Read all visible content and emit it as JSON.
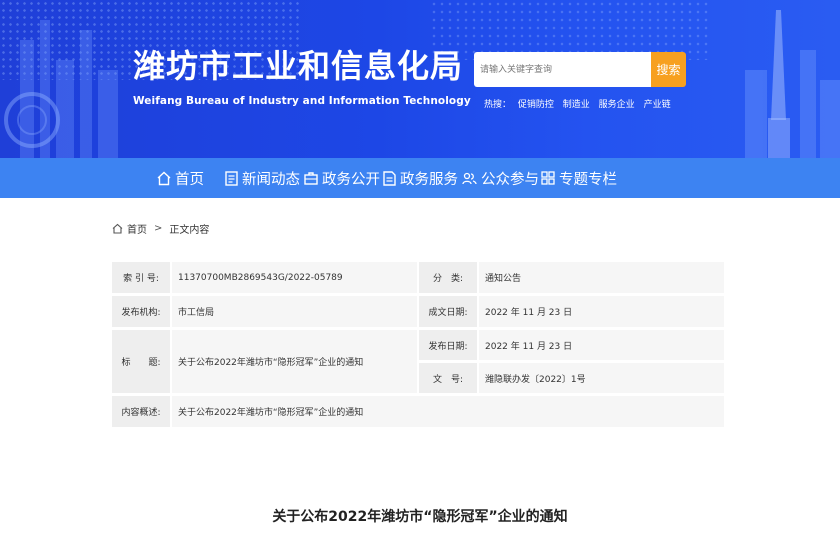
{
  "header": {
    "title": "潍坊市工业和信息化局",
    "subtitle": "Weifang Bureau of Industry and Information Technology",
    "search": {
      "placeholder": "请输入关键字查询",
      "button_label": "搜索"
    },
    "hot": {
      "label": "热搜：",
      "links": [
        "促销防控",
        "制造业",
        "服务企业",
        "产业链"
      ]
    }
  },
  "nav": {
    "items": [
      {
        "label": "首页",
        "icon": "home-icon"
      },
      {
        "label": "新闻动态",
        "icon": "news-icon"
      },
      {
        "label": "政务公开",
        "icon": "briefcase-icon"
      },
      {
        "label": "政务服务",
        "icon": "document-icon"
      },
      {
        "label": "公众参与",
        "icon": "people-icon"
      },
      {
        "label": "专题专栏",
        "icon": "grid-icon"
      }
    ]
  },
  "breadcrumb": {
    "home": "首页",
    "separator": ">",
    "current": "正文内容"
  },
  "meta": {
    "index_label": "索 引 号:",
    "index_value": "11370700MB2869543G/2022-05789",
    "category_label": "分　类:",
    "category_value": "通知公告",
    "publisher_label": "发布机构:",
    "publisher_value": "市工信局",
    "created_label": "成文日期:",
    "created_value": "2022 年 11 月 23 日",
    "title_label": "标　　题:",
    "title_value": "关于公布2022年潍坊市“隐形冠军”企业的通知",
    "published_label": "发布日期:",
    "published_value": "2022 年 11 月 23 日",
    "docno_label": "文　号:",
    "docno_value": "潍隐联办发〔2022〕1号",
    "summary_label": "内容概述:",
    "summary_value": "关于公布2022年潍坊市“隐形冠军”企业的通知"
  },
  "article": {
    "title": "关于公布2022年潍坊市“隐形冠军”企业的通知"
  },
  "colors": {
    "banner": "#1f45e0",
    "nav": "#3d83f2",
    "search_button": "#f7a01f",
    "label_bg": "#eeeeee",
    "value_bg": "#f6f6f6"
  }
}
